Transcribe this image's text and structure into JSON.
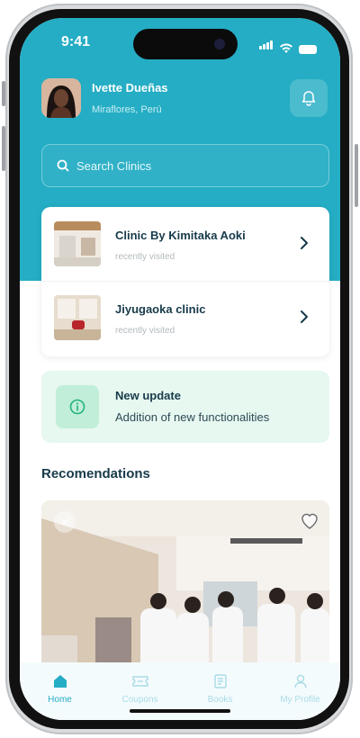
{
  "status_bar": {
    "time": "9:41"
  },
  "header": {
    "user_name": "Ivette Dueñas",
    "location": "Miraflores, Perú"
  },
  "search": {
    "placeholder": "Search Clinics"
  },
  "clinics": [
    {
      "name": "Clinic By Kimitaka Aoki",
      "subtitle": "recently visited"
    },
    {
      "name": "Jiyugaoka clinic",
      "subtitle": "recently visited"
    }
  ],
  "update": {
    "title": "New update",
    "text": "Addition of new functionalities"
  },
  "recommendations": {
    "title": "Recomendations"
  },
  "tabs": [
    {
      "label": "Home",
      "icon": "home-icon",
      "active": true
    },
    {
      "label": "Coupons",
      "icon": "coupon-icon",
      "active": false
    },
    {
      "label": "Books",
      "icon": "book-icon",
      "active": false
    },
    {
      "label": "My Profile",
      "icon": "profile-icon",
      "active": false
    }
  ],
  "colors": {
    "primary": "#24adc4",
    "update_bg": "#e6f8f0",
    "update_icon": "#22b37a",
    "text_dark": "#173a4a"
  }
}
